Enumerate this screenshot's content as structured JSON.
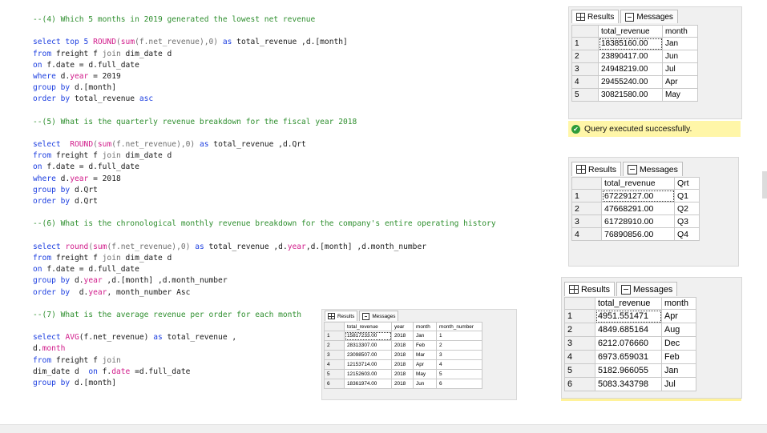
{
  "code": [
    [
      {
        "t": "--(4) Which 5 months in 2019 generated the lowest net revenue",
        "c": "cm"
      }
    ],
    [],
    [
      {
        "t": "select top 5 ",
        "c": "kw"
      },
      {
        "t": "ROUND",
        "c": "fn"
      },
      {
        "t": "(",
        "c": "gr"
      },
      {
        "t": "sum",
        "c": "fn"
      },
      {
        "t": "(f.net_revenue),0) ",
        "c": "gr"
      },
      {
        "t": "as",
        "c": "kw"
      },
      {
        "t": " total_revenue ,d.[month]",
        "c": "nm"
      }
    ],
    [
      {
        "t": "from",
        "c": "kw"
      },
      {
        "t": " freight f ",
        "c": "nm"
      },
      {
        "t": "join",
        "c": "gr"
      },
      {
        "t": " dim_date d",
        "c": "nm"
      }
    ],
    [
      {
        "t": "on",
        "c": "kw"
      },
      {
        "t": " f.date = d.full_date",
        "c": "nm"
      }
    ],
    [
      {
        "t": "where",
        "c": "kw"
      },
      {
        "t": " d.",
        "c": "nm"
      },
      {
        "t": "year",
        "c": "fn"
      },
      {
        "t": " = 2019",
        "c": "nm"
      }
    ],
    [
      {
        "t": "group by",
        "c": "kw"
      },
      {
        "t": " d.[month]",
        "c": "nm"
      }
    ],
    [
      {
        "t": "order by",
        "c": "kw"
      },
      {
        "t": " total_revenue ",
        "c": "nm"
      },
      {
        "t": "asc",
        "c": "kw"
      }
    ],
    [],
    [
      {
        "t": "--(5) What is the quarterly revenue breakdown for the fiscal year 2018",
        "c": "cm"
      }
    ],
    [],
    [
      {
        "t": "select  ",
        "c": "kw"
      },
      {
        "t": "ROUND",
        "c": "fn"
      },
      {
        "t": "(",
        "c": "gr"
      },
      {
        "t": "sum",
        "c": "fn"
      },
      {
        "t": "(f.net_revenue),0) ",
        "c": "gr"
      },
      {
        "t": "as",
        "c": "kw"
      },
      {
        "t": " total_revenue ,d.Qrt",
        "c": "nm"
      }
    ],
    [
      {
        "t": "from",
        "c": "kw"
      },
      {
        "t": " freight f ",
        "c": "nm"
      },
      {
        "t": "join",
        "c": "gr"
      },
      {
        "t": " dim_date d",
        "c": "nm"
      }
    ],
    [
      {
        "t": "on",
        "c": "kw"
      },
      {
        "t": " f.date = d.full_date",
        "c": "nm"
      }
    ],
    [
      {
        "t": "where",
        "c": "kw"
      },
      {
        "t": " d.",
        "c": "nm"
      },
      {
        "t": "year",
        "c": "fn"
      },
      {
        "t": " = 2018",
        "c": "nm"
      }
    ],
    [
      {
        "t": "group by",
        "c": "kw"
      },
      {
        "t": " d.Qrt",
        "c": "nm"
      }
    ],
    [
      {
        "t": "order by",
        "c": "kw"
      },
      {
        "t": " d.Qrt",
        "c": "nm"
      }
    ],
    [],
    [
      {
        "t": "--(6) What is the chronological monthly revenue breakdown for the company's entire operating history",
        "c": "cm"
      }
    ],
    [],
    [
      {
        "t": "select ",
        "c": "kw"
      },
      {
        "t": "round",
        "c": "fn"
      },
      {
        "t": "(",
        "c": "gr"
      },
      {
        "t": "sum",
        "c": "fn"
      },
      {
        "t": "(f.net_revenue),0) ",
        "c": "gr"
      },
      {
        "t": "as",
        "c": "kw"
      },
      {
        "t": " total_revenue ,d.",
        "c": "nm"
      },
      {
        "t": "year",
        "c": "fn"
      },
      {
        "t": ",d.[month] ,d.month_number",
        "c": "nm"
      }
    ],
    [
      {
        "t": "from",
        "c": "kw"
      },
      {
        "t": " freight f ",
        "c": "nm"
      },
      {
        "t": "join",
        "c": "gr"
      },
      {
        "t": " dim_date d",
        "c": "nm"
      }
    ],
    [
      {
        "t": "on",
        "c": "kw"
      },
      {
        "t": " f.date = d.full_date",
        "c": "nm"
      }
    ],
    [
      {
        "t": "group by",
        "c": "kw"
      },
      {
        "t": " d.",
        "c": "nm"
      },
      {
        "t": "year",
        "c": "fn"
      },
      {
        "t": " ,d.[month] ,d.month_number",
        "c": "nm"
      }
    ],
    [
      {
        "t": "order by",
        "c": "kw"
      },
      {
        "t": "  d.",
        "c": "nm"
      },
      {
        "t": "year",
        "c": "fn"
      },
      {
        "t": ", month_number Asc",
        "c": "nm"
      }
    ],
    [],
    [
      {
        "t": "--(7) What is the average revenue per order for each month",
        "c": "cm"
      }
    ],
    [],
    [
      {
        "t": "select ",
        "c": "kw"
      },
      {
        "t": "AVG",
        "c": "fn"
      },
      {
        "t": "(f.net_revenue) ",
        "c": "nm"
      },
      {
        "t": "as",
        "c": "kw"
      },
      {
        "t": " total_revenue ,",
        "c": "nm"
      }
    ],
    [
      {
        "t": "d.",
        "c": "nm"
      },
      {
        "t": "month",
        "c": "fn"
      }
    ],
    [
      {
        "t": "from",
        "c": "kw"
      },
      {
        "t": " freight f ",
        "c": "nm"
      },
      {
        "t": "join",
        "c": "gr"
      }
    ],
    [
      {
        "t": "dim_date d  ",
        "c": "nm"
      },
      {
        "t": "on",
        "c": "kw"
      },
      {
        "t": " f.",
        "c": "nm"
      },
      {
        "t": "date",
        "c": "fn"
      },
      {
        "t": " =d.full_date",
        "c": "nm"
      }
    ],
    [
      {
        "t": "group by",
        "c": "kw"
      },
      {
        "t": " d.[month]",
        "c": "nm"
      }
    ]
  ],
  "grids": [
    {
      "id": "q4",
      "tabs": {
        "results": "Results",
        "messages": "Messages"
      },
      "columns": [
        "total_revenue",
        "month"
      ],
      "rows": [
        [
          "1",
          "18385160.00",
          "Jan"
        ],
        [
          "2",
          "23890417.00",
          "Jun"
        ],
        [
          "3",
          "24948219.00",
          "Jul"
        ],
        [
          "4",
          "29455240.00",
          "Apr"
        ],
        [
          "5",
          "30821580.00",
          "May"
        ]
      ]
    },
    {
      "id": "q5",
      "tabs": {
        "results": "Results",
        "messages": "Messages"
      },
      "columns": [
        "total_revenue",
        "Qrt"
      ],
      "rows": [
        [
          "1",
          "67229127.00",
          "Q1"
        ],
        [
          "2",
          "47668291.00",
          "Q2"
        ],
        [
          "3",
          "61728910.00",
          "Q3"
        ],
        [
          "4",
          "76890856.00",
          "Q4"
        ]
      ]
    },
    {
      "id": "q7",
      "tabs": {
        "results": "Results",
        "messages": "Messages"
      },
      "columns": [
        "total_revenue",
        "month"
      ],
      "rows": [
        [
          "1",
          "4951.551471",
          "Apr"
        ],
        [
          "2",
          "4849.685164",
          "Aug"
        ],
        [
          "3",
          "6212.076660",
          "Dec"
        ],
        [
          "4",
          "6973.659031",
          "Feb"
        ],
        [
          "5",
          "5182.966055",
          "Jan"
        ],
        [
          "6",
          "5083.343798",
          "Jul"
        ]
      ]
    },
    {
      "id": "q6",
      "tabs": {
        "results": "Results",
        "messages": "Messages"
      },
      "columns": [
        "total_revenue",
        "year",
        "month",
        "month_number"
      ],
      "rows": [
        [
          "1",
          "15817233.00",
          "2018",
          "Jan",
          "1"
        ],
        [
          "2",
          "28313307.00",
          "2018",
          "Feb",
          "2"
        ],
        [
          "3",
          "23098507.00",
          "2018",
          "Mar",
          "3"
        ],
        [
          "4",
          "12153714.00",
          "2018",
          "Apr",
          "4"
        ],
        [
          "5",
          "12152603.00",
          "2018",
          "May",
          "5"
        ],
        [
          "6",
          "18361974.00",
          "2018",
          "Jun",
          "6"
        ]
      ]
    }
  ],
  "status": {
    "message": "Query executed successfully."
  },
  "colors": {
    "comment": "#2f8f2f",
    "keyword": "#1d3fe0",
    "function": "#d11b8a",
    "success": "#2e9c3a",
    "success_bg": "#fff6a8"
  }
}
